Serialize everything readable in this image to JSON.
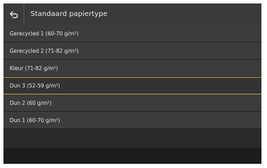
{
  "header": {
    "title": "Standaard papiertype",
    "back_icon": "back-arrow-icon"
  },
  "list": {
    "items": [
      {
        "label": "Gerecycled 1 (60-70 g/m²)"
      },
      {
        "label": "Gerecycled 2 (71-82 g/m²)"
      },
      {
        "label": "Kleur (71-82 g/m²)"
      },
      {
        "label": "Dun 3 (52-59 g/m²)"
      },
      {
        "label": "Dun 2 (60 g/m²)"
      },
      {
        "label": "Dun 1 (60-70 g/m²)"
      }
    ],
    "selected_index": 3
  },
  "colors": {
    "background": "#2a2a2a",
    "item": "#3c3c3c",
    "selected_border": "#b9a24a",
    "text": "#e6e6e6"
  }
}
